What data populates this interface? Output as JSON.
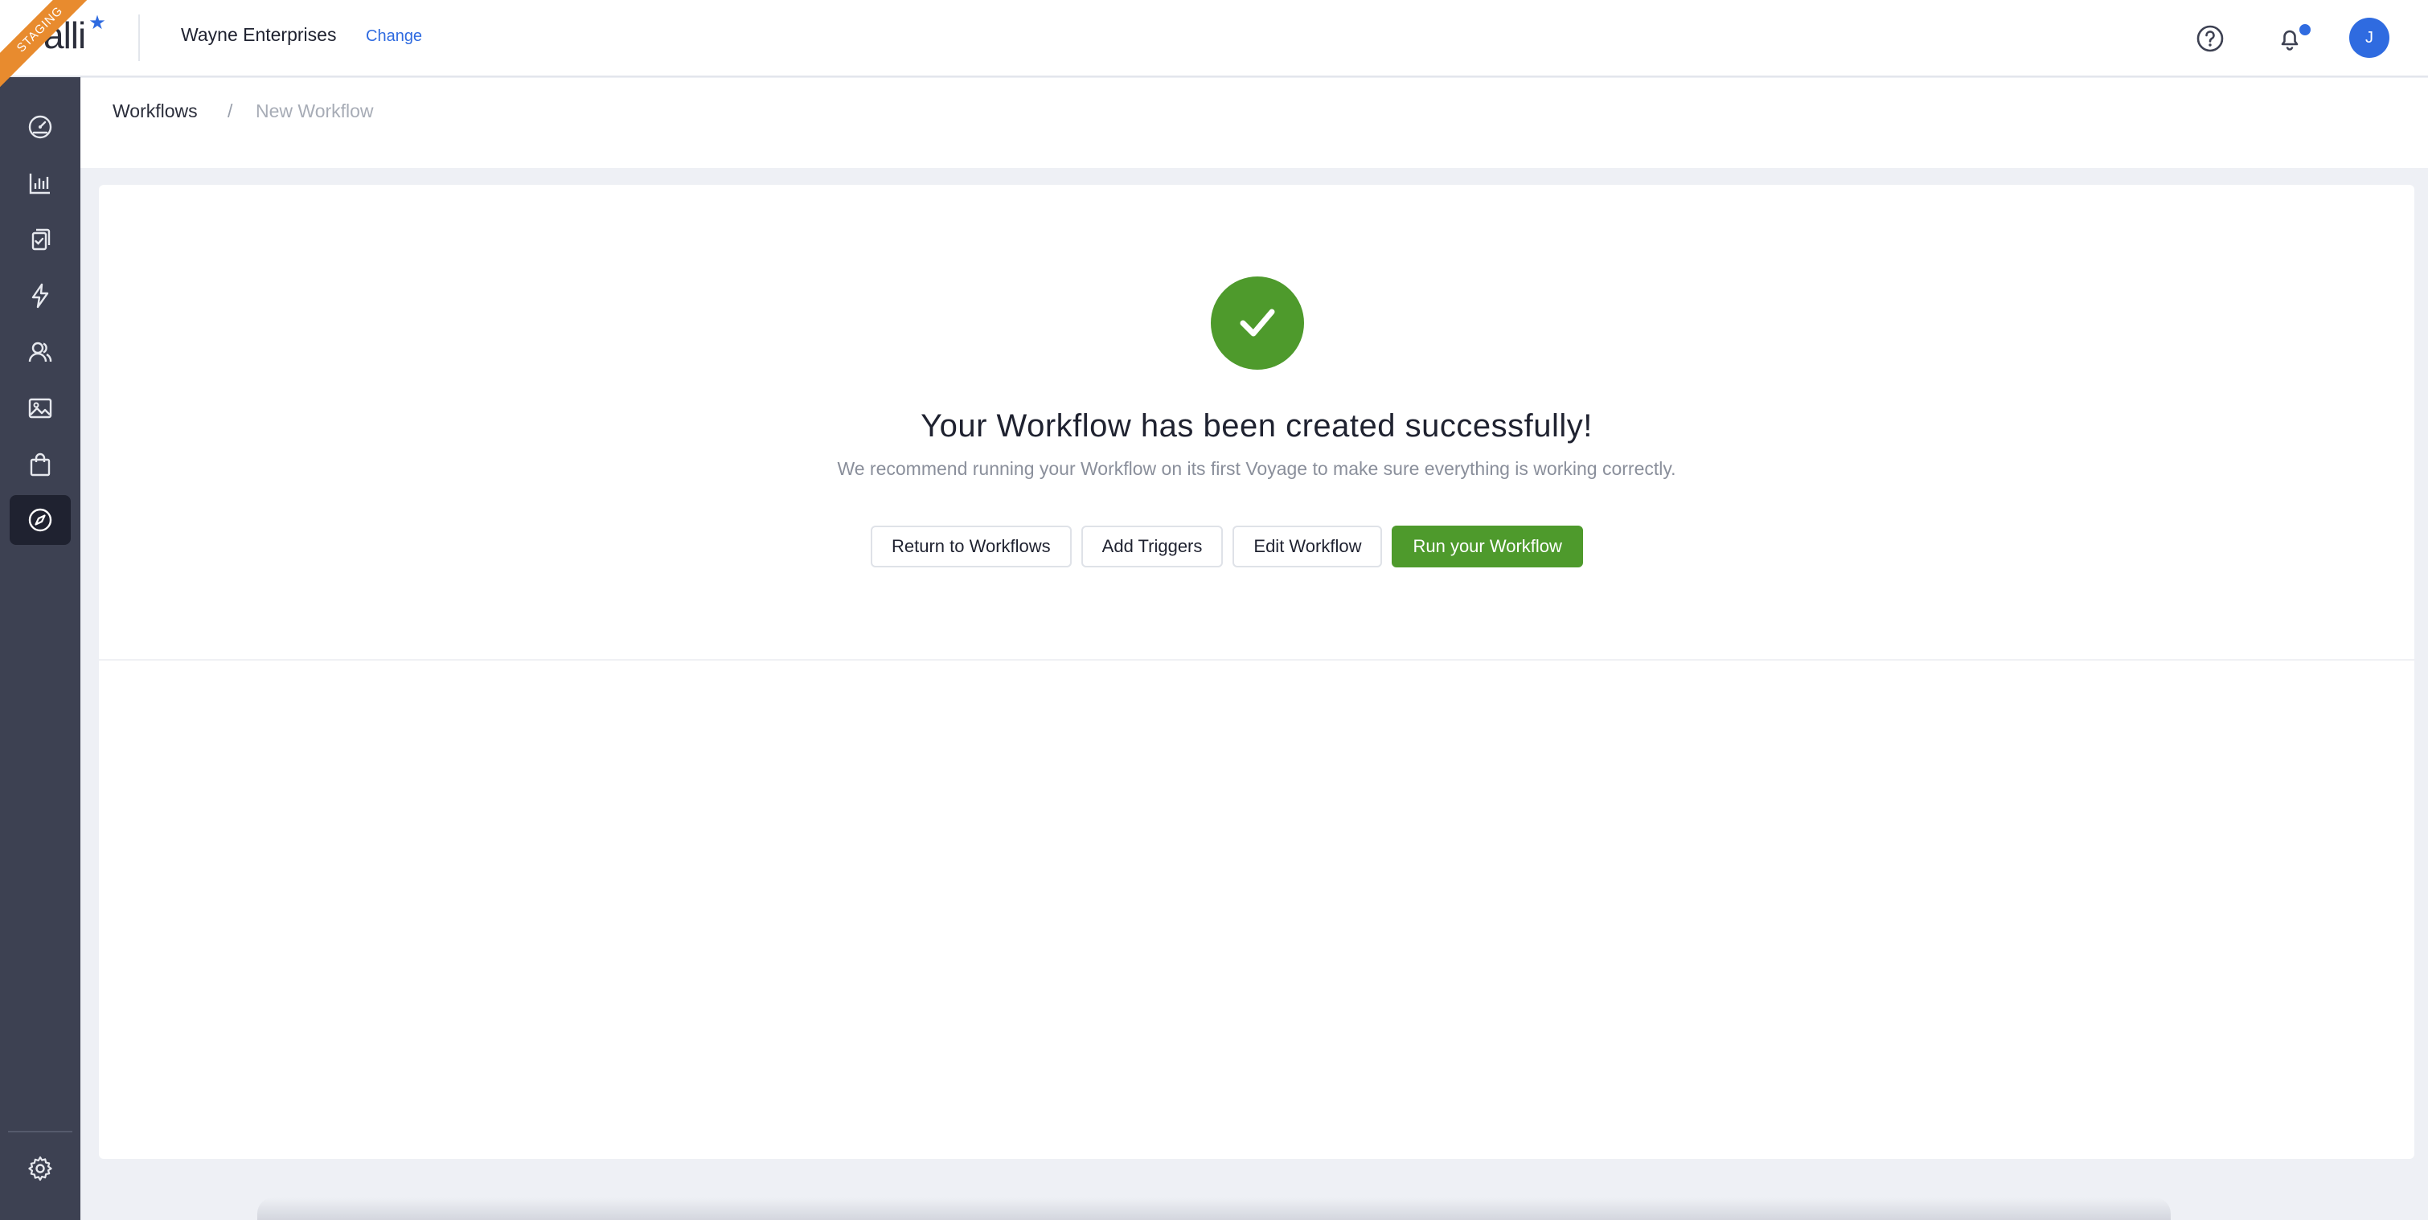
{
  "header": {
    "environment_badge": "STAGING",
    "logo_text": "alli",
    "org_name": "Wayne Enterprises",
    "change_label": "Change",
    "avatar_initial": "J",
    "icons": [
      "help-icon",
      "bell-icon"
    ]
  },
  "sidebar": {
    "items": [
      {
        "icon": "dashboard-gauge-icon",
        "active": false
      },
      {
        "icon": "bar-chart-icon",
        "active": false
      },
      {
        "icon": "clipboard-check-icon",
        "active": false
      },
      {
        "icon": "lightning-icon",
        "active": false
      },
      {
        "icon": "users-icon",
        "active": false
      },
      {
        "icon": "image-icon",
        "active": false
      },
      {
        "icon": "shopping-bag-icon",
        "active": false
      },
      {
        "icon": "compass-icon",
        "active": true
      }
    ],
    "footer_icon": "gear-icon"
  },
  "breadcrumb": {
    "root": "Workflows",
    "separator": "/",
    "current": "New Workflow"
  },
  "main": {
    "title": "Your Workflow has been created successfully!",
    "subtitle": "We recommend running your Workflow on its first Voyage to make sure everything is working correctly.",
    "buttons": {
      "return": "Return to Workflows",
      "add_triggers": "Add Triggers",
      "edit": "Edit Workflow",
      "run": "Run your Workflow"
    }
  },
  "colors": {
    "accent": "#2f6be0",
    "success": "#4e9a2c",
    "sidebar": "#3d4152",
    "staging": "#e88b2e"
  }
}
